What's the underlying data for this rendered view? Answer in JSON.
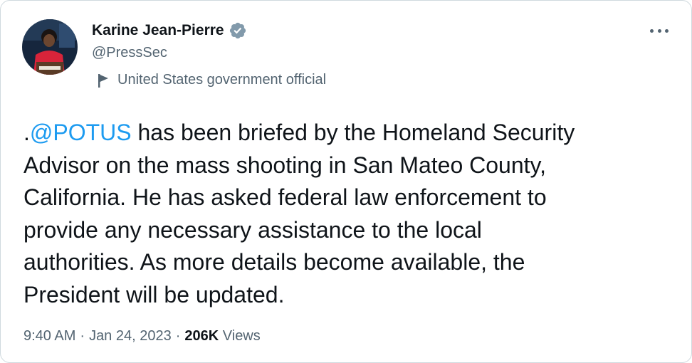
{
  "author": {
    "display_name": "Karine Jean-Pierre",
    "handle": "@PressSec",
    "verified": true,
    "label": "United States government official"
  },
  "tweet": {
    "text_prefix": ".",
    "mention": "@POTUS",
    "text_lines": [
      " has been briefed by the Homeland Security",
      "Advisor on the mass shooting in San Mateo County,",
      "California. He has asked federal law enforcement to",
      "provide any necessary assistance to the local",
      "authorities. As more details become available, the",
      "President will be updated."
    ]
  },
  "meta": {
    "time": "9:40 AM",
    "separator": "·",
    "date": "Jan 24, 2023",
    "views_count": "206K",
    "views_label": "Views"
  },
  "colors": {
    "link": "#1d9bf0",
    "text": "#0f1419",
    "secondary": "#536471",
    "border": "#cfd9de",
    "verified_badge": "#829aab"
  },
  "icons": {
    "more": "more-horizontal-icon",
    "verified": "verified-badge-icon",
    "label": "flag-icon"
  }
}
